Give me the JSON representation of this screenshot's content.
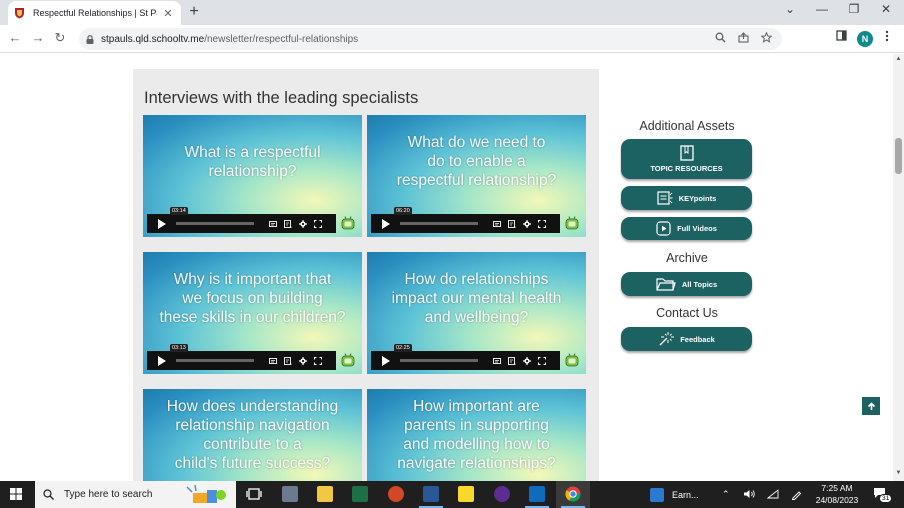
{
  "browser": {
    "tab_title": "Respectful Relationships | St Paul's",
    "tab_close": "✕",
    "new_tab": "+",
    "url_host": "stpauls.qld.schooltv.me",
    "url_path": "/newsletter/respectful-relationships",
    "profile_initial": "N",
    "window_controls": {
      "dropdown": "⌄",
      "minimize": "—",
      "restore": "❐",
      "close": "✕"
    },
    "nav": {
      "back": "←",
      "forward": "→",
      "reload": "↻"
    }
  },
  "main": {
    "heading": "Interviews with the leading specialists",
    "videos": [
      {
        "title_lines": [
          "What is a respectful",
          "relationship?"
        ],
        "time": "03:14"
      },
      {
        "title_lines": [
          "What do we need to",
          "do to enable a",
          "respectful relationship?"
        ],
        "time": "06:20"
      },
      {
        "title_lines": [
          "Why is it important that",
          "we focus on building",
          "these skills in our children?"
        ],
        "time": "03:13"
      },
      {
        "title_lines": [
          "How do relationships",
          "impact our mental health",
          "and wellbeing?"
        ],
        "time": "02:25"
      },
      {
        "title_lines": [
          "How does understanding",
          "relationship navigation",
          "contribute to a",
          "child's future success?"
        ],
        "time": ""
      },
      {
        "title_lines": [
          "How important are",
          "parents in supporting",
          "and modelling how to",
          "navigate relationships?"
        ],
        "time": ""
      }
    ]
  },
  "sidebar": {
    "additional_assets": "Additional Assets",
    "topic_resources": "TOPIC RESOURCES",
    "keypoints": "KEYpoints",
    "full_videos": "Full Videos",
    "archive": "Archive",
    "all_topics": "All Topics",
    "contact_us": "Contact Us",
    "feedback": "Feedback"
  },
  "taskbar": {
    "search_placeholder": "Type here to search",
    "weather_label": "Earn...",
    "time": "7:25 AM",
    "date": "24/08/2023",
    "notification_count": "31"
  },
  "colors": {
    "accent": "#1d6263",
    "panel": "#ebebeb"
  }
}
